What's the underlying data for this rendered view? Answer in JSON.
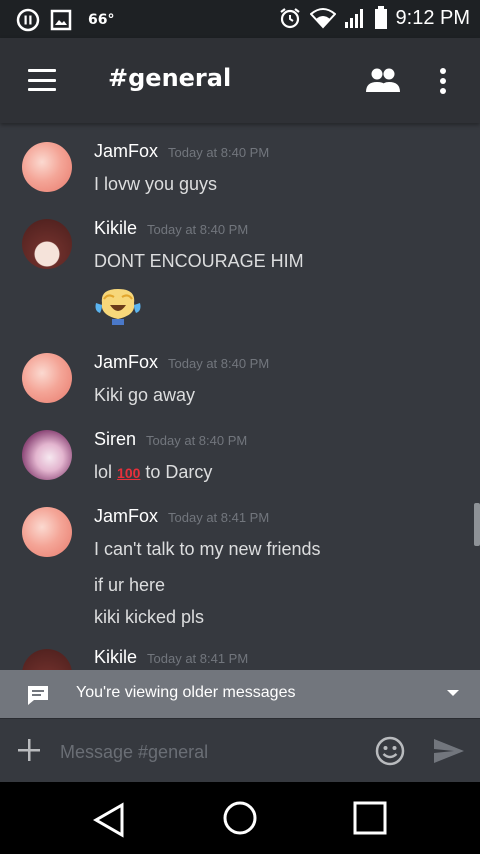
{
  "status_bar": {
    "temperature": "66°",
    "time": "9:12 PM",
    "icons": [
      "pause-icon",
      "image-icon",
      "alarm-icon",
      "wifi-icon",
      "signal-icon",
      "battery-icon"
    ]
  },
  "app_bar": {
    "channel_title": "#general",
    "icons": [
      "hamburger-menu-icon",
      "members-icon",
      "overflow-menu-icon"
    ]
  },
  "messages": [
    {
      "author": "JamFox",
      "time": "Today at 8:40 PM",
      "lines": [
        "I lovw you guys"
      ]
    },
    {
      "author": "Kikile",
      "time": "Today at 8:40 PM",
      "lines": [
        "DONT ENCOURAGE HIM"
      ],
      "emoji": "crying-laughing-anime-emoji"
    },
    {
      "author": "JamFox",
      "time": "Today at 8:40 PM",
      "lines": [
        "Kiki go away"
      ]
    },
    {
      "author": "Siren",
      "time": "Today at 8:40 PM",
      "text_before": "lol",
      "emoji_100": "100",
      "text_after": "to Darcy"
    },
    {
      "author": "JamFox",
      "time": "Today at 8:41 PM",
      "lines": [
        "I can't talk to my new friends",
        "if ur here",
        "kiki kicked pls"
      ]
    },
    {
      "author": "Kikile",
      "time": "Today at 8:41 PM",
      "lines": []
    }
  ],
  "older_banner": {
    "text": "You're viewing older messages"
  },
  "composer": {
    "placeholder": "Message #general"
  },
  "colors": {
    "background": "#36393f",
    "app_bar": "#2f3136",
    "status_bar": "#1e2124",
    "banner": "#72767d"
  }
}
